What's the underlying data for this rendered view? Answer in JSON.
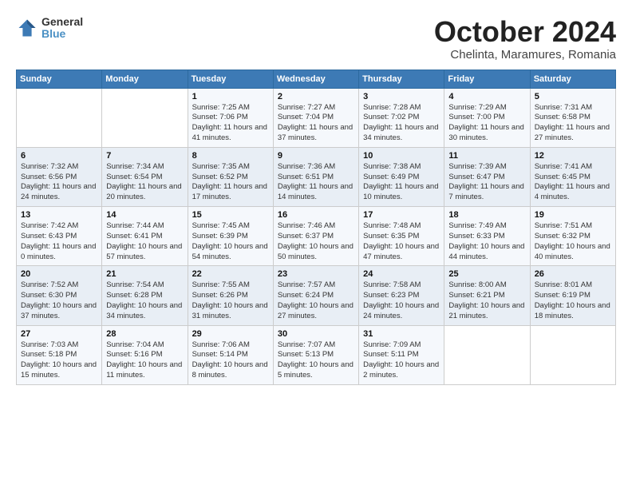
{
  "header": {
    "logo_general": "General",
    "logo_blue": "Blue",
    "month_title": "October 2024",
    "location": "Chelinta, Maramures, Romania"
  },
  "days_of_week": [
    "Sunday",
    "Monday",
    "Tuesday",
    "Wednesday",
    "Thursday",
    "Friday",
    "Saturday"
  ],
  "weeks": [
    [
      {
        "day": "",
        "info": ""
      },
      {
        "day": "",
        "info": ""
      },
      {
        "day": "1",
        "info": "Sunrise: 7:25 AM\nSunset: 7:06 PM\nDaylight: 11 hours and 41 minutes."
      },
      {
        "day": "2",
        "info": "Sunrise: 7:27 AM\nSunset: 7:04 PM\nDaylight: 11 hours and 37 minutes."
      },
      {
        "day": "3",
        "info": "Sunrise: 7:28 AM\nSunset: 7:02 PM\nDaylight: 11 hours and 34 minutes."
      },
      {
        "day": "4",
        "info": "Sunrise: 7:29 AM\nSunset: 7:00 PM\nDaylight: 11 hours and 30 minutes."
      },
      {
        "day": "5",
        "info": "Sunrise: 7:31 AM\nSunset: 6:58 PM\nDaylight: 11 hours and 27 minutes."
      }
    ],
    [
      {
        "day": "6",
        "info": "Sunrise: 7:32 AM\nSunset: 6:56 PM\nDaylight: 11 hours and 24 minutes."
      },
      {
        "day": "7",
        "info": "Sunrise: 7:34 AM\nSunset: 6:54 PM\nDaylight: 11 hours and 20 minutes."
      },
      {
        "day": "8",
        "info": "Sunrise: 7:35 AM\nSunset: 6:52 PM\nDaylight: 11 hours and 17 minutes."
      },
      {
        "day": "9",
        "info": "Sunrise: 7:36 AM\nSunset: 6:51 PM\nDaylight: 11 hours and 14 minutes."
      },
      {
        "day": "10",
        "info": "Sunrise: 7:38 AM\nSunset: 6:49 PM\nDaylight: 11 hours and 10 minutes."
      },
      {
        "day": "11",
        "info": "Sunrise: 7:39 AM\nSunset: 6:47 PM\nDaylight: 11 hours and 7 minutes."
      },
      {
        "day": "12",
        "info": "Sunrise: 7:41 AM\nSunset: 6:45 PM\nDaylight: 11 hours and 4 minutes."
      }
    ],
    [
      {
        "day": "13",
        "info": "Sunrise: 7:42 AM\nSunset: 6:43 PM\nDaylight: 11 hours and 0 minutes."
      },
      {
        "day": "14",
        "info": "Sunrise: 7:44 AM\nSunset: 6:41 PM\nDaylight: 10 hours and 57 minutes."
      },
      {
        "day": "15",
        "info": "Sunrise: 7:45 AM\nSunset: 6:39 PM\nDaylight: 10 hours and 54 minutes."
      },
      {
        "day": "16",
        "info": "Sunrise: 7:46 AM\nSunset: 6:37 PM\nDaylight: 10 hours and 50 minutes."
      },
      {
        "day": "17",
        "info": "Sunrise: 7:48 AM\nSunset: 6:35 PM\nDaylight: 10 hours and 47 minutes."
      },
      {
        "day": "18",
        "info": "Sunrise: 7:49 AM\nSunset: 6:33 PM\nDaylight: 10 hours and 44 minutes."
      },
      {
        "day": "19",
        "info": "Sunrise: 7:51 AM\nSunset: 6:32 PM\nDaylight: 10 hours and 40 minutes."
      }
    ],
    [
      {
        "day": "20",
        "info": "Sunrise: 7:52 AM\nSunset: 6:30 PM\nDaylight: 10 hours and 37 minutes."
      },
      {
        "day": "21",
        "info": "Sunrise: 7:54 AM\nSunset: 6:28 PM\nDaylight: 10 hours and 34 minutes."
      },
      {
        "day": "22",
        "info": "Sunrise: 7:55 AM\nSunset: 6:26 PM\nDaylight: 10 hours and 31 minutes."
      },
      {
        "day": "23",
        "info": "Sunrise: 7:57 AM\nSunset: 6:24 PM\nDaylight: 10 hours and 27 minutes."
      },
      {
        "day": "24",
        "info": "Sunrise: 7:58 AM\nSunset: 6:23 PM\nDaylight: 10 hours and 24 minutes."
      },
      {
        "day": "25",
        "info": "Sunrise: 8:00 AM\nSunset: 6:21 PM\nDaylight: 10 hours and 21 minutes."
      },
      {
        "day": "26",
        "info": "Sunrise: 8:01 AM\nSunset: 6:19 PM\nDaylight: 10 hours and 18 minutes."
      }
    ],
    [
      {
        "day": "27",
        "info": "Sunrise: 7:03 AM\nSunset: 5:18 PM\nDaylight: 10 hours and 15 minutes."
      },
      {
        "day": "28",
        "info": "Sunrise: 7:04 AM\nSunset: 5:16 PM\nDaylight: 10 hours and 11 minutes."
      },
      {
        "day": "29",
        "info": "Sunrise: 7:06 AM\nSunset: 5:14 PM\nDaylight: 10 hours and 8 minutes."
      },
      {
        "day": "30",
        "info": "Sunrise: 7:07 AM\nSunset: 5:13 PM\nDaylight: 10 hours and 5 minutes."
      },
      {
        "day": "31",
        "info": "Sunrise: 7:09 AM\nSunset: 5:11 PM\nDaylight: 10 hours and 2 minutes."
      },
      {
        "day": "",
        "info": ""
      },
      {
        "day": "",
        "info": ""
      }
    ]
  ]
}
